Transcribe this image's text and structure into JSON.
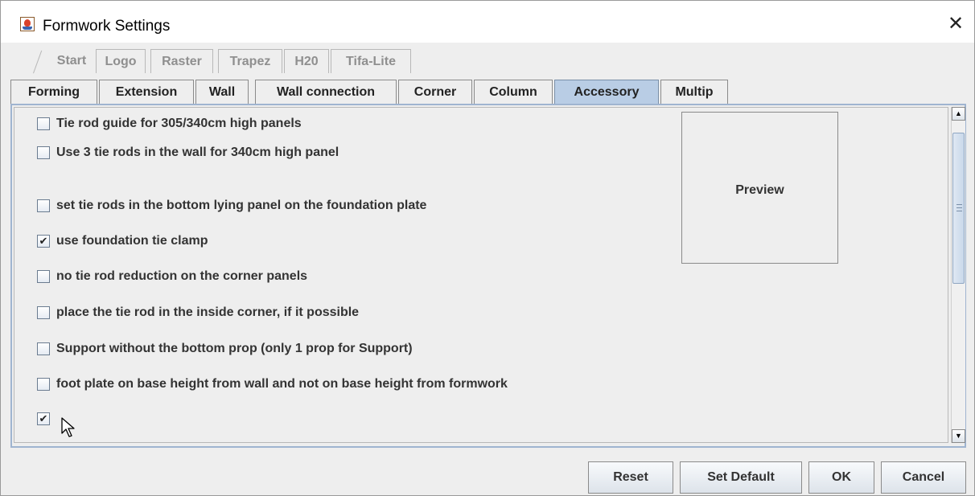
{
  "window": {
    "title": "Formwork Settings",
    "close_icon": "close-icon"
  },
  "tabs_row1": [
    "Start",
    "Logo",
    "Raster",
    "Trapez",
    "H20",
    "Tifa-Lite"
  ],
  "tabs_row2": [
    "Forming",
    "Extension",
    "Wall",
    "Wall connection",
    "Corner",
    "Column",
    "Accessory",
    "Multip"
  ],
  "selected_tab": "Accessory",
  "checkboxes": [
    {
      "label": "Tie rod guide for 305/340cm high panels",
      "checked": false,
      "mark": ""
    },
    {
      "label": "Use 3 tie rods in the wall for 340cm high panel",
      "checked": false,
      "mark": ""
    },
    {
      "label": "set tie rods in the bottom lying panel on the foundation plate",
      "checked": false,
      "mark": ""
    },
    {
      "label": "use foundation tie clamp",
      "checked": true,
      "mark": "✔"
    },
    {
      "label": "no tie rod reduction on the corner panels",
      "checked": false,
      "mark": ""
    },
    {
      "label": "place the tie rod in the inside corner, if it possible",
      "checked": false,
      "mark": ""
    },
    {
      "label": "Support without the bottom prop (only 1 prop for Support)",
      "checked": false,
      "mark": ""
    },
    {
      "label": "foot plate on base height from wall and not on base height from formwork",
      "checked": false,
      "mark": ""
    },
    {
      "label": "",
      "checked": true,
      "mark": "✔"
    }
  ],
  "preview": {
    "label": "Preview"
  },
  "buttons": {
    "reset": "Reset",
    "set_default": "Set Default",
    "ok": "OK",
    "cancel": "Cancel"
  },
  "scrollbar": {
    "up_arrow": "▲",
    "down_arrow": "▼"
  },
  "colors": {
    "selected_tab": "#b9cde5",
    "content_border": "#9fb4d0",
    "window_bg": "#eeeeee"
  }
}
